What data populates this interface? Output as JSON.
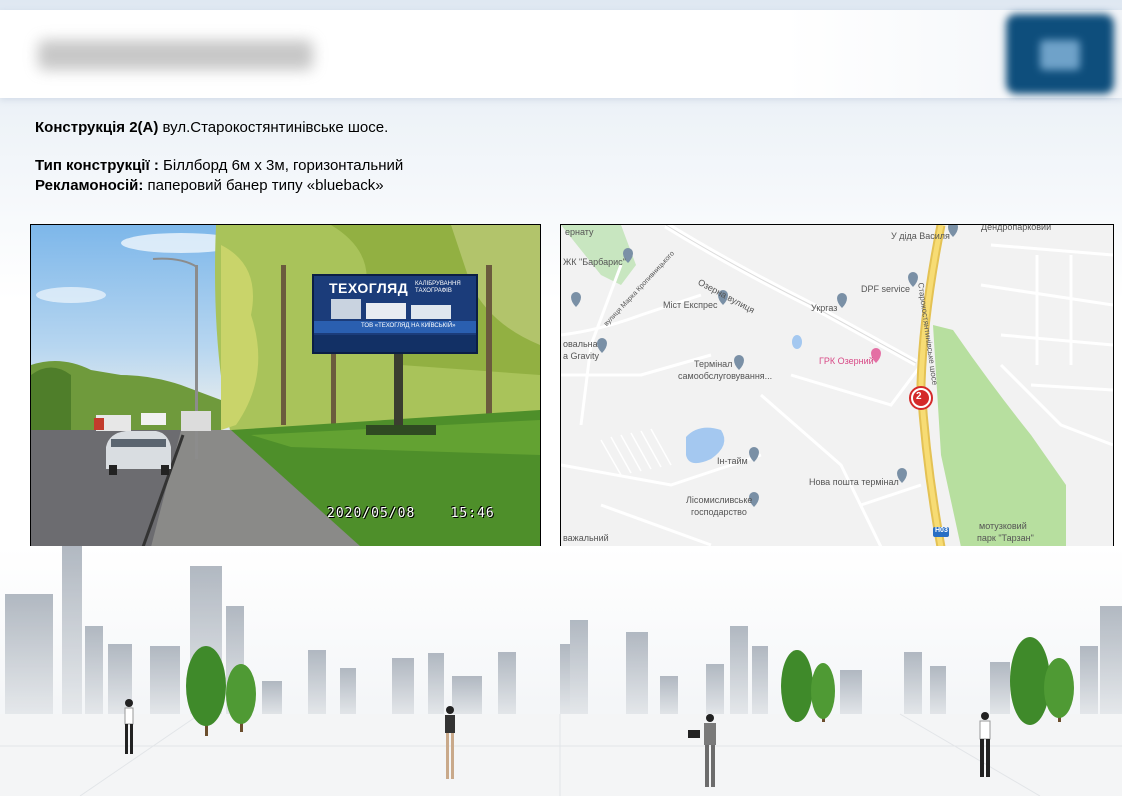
{
  "header": {
    "title_blurred": "",
    "logo": "company-logo-blurred"
  },
  "info": {
    "construction_label": "Конструкція 2(А)",
    "construction_address": "вул.Старокостянтинівське шосе.",
    "type_label": "Тип конструкції :",
    "type_value": "Біллборд 6м х 3м, горизонтальний",
    "carrier_label": "Рекламоносій:",
    "carrier_value": "паперовий банер типу «blueback»"
  },
  "photo": {
    "billboard_headline": "ТЕХОГЛЯД",
    "billboard_sub1": "КАЛІБРУВАННЯ",
    "billboard_sub2": "ТАХОГРАФІВ",
    "billboard_company": "ТОВ «ТЕХОГЛЯД НА КИЇВСЬКІЙ»",
    "timestamp_date": "2020/05/08",
    "timestamp_time": "15:46"
  },
  "map": {
    "labels": {
      "top_left": "ернату",
      "barbaris": "ЖК \"Барбарис\"",
      "u_dida": "У діда Василя",
      "dendro": "Дендропарковий",
      "dpf": "DPF service",
      "ukrgaz": "Укргаз",
      "ozerna": "Озерна вулиця",
      "kropyv": "вулиця Марка Кропивницького",
      "mist": "Міст Експрес",
      "gravity1": "овальна",
      "gravity2": "a Gravity",
      "terminal1": "Термінал",
      "terminal2": "самообслуговування...",
      "grk": "ГРК Озерний",
      "road": "Старокостянтинівське шосе",
      "in_taim": "Ін-тайм",
      "nova": "Нова пошта термінал",
      "lisomysl1": "Лісомисливське",
      "lisomysl2": "господарство",
      "vazh": "важальний",
      "motuz1": "мотузковий",
      "motuz2": "парк \"Тарзан\"",
      "road_code": "Н03",
      "marker": "2"
    }
  }
}
